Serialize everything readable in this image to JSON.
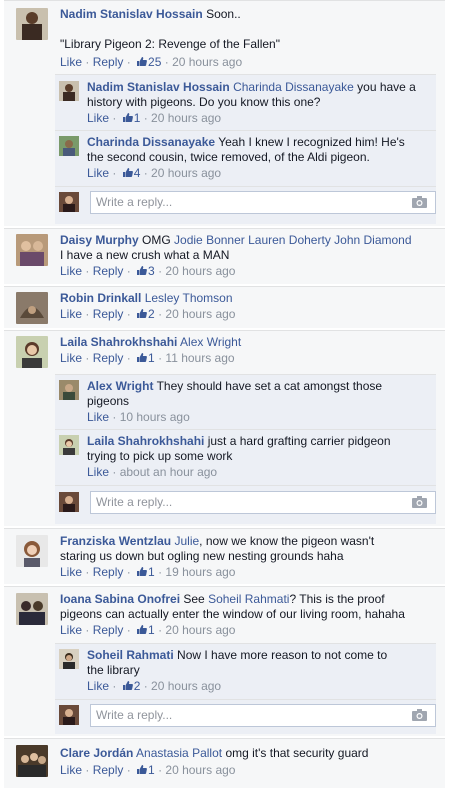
{
  "ui": {
    "like": "Like",
    "reply": "Reply",
    "reply_placeholder": "Write a reply..."
  },
  "comments": [
    {
      "name": "Nadim Stanislav Hossain",
      "text": "Soon..",
      "text2": "\"Library Pigeon 2: Revenge of the Fallen\"",
      "likes": "25",
      "time": "20 hours ago",
      "replies": [
        {
          "name": "Nadim Stanislav Hossain",
          "tag": "Charinda Dissanayake",
          "text": "you have a",
          "text2": "history with pigeons. Do you know this one?",
          "likes": "1",
          "time": "20 hours ago"
        },
        {
          "name": "Charinda Dissanayake",
          "text": "Yeah I knew I recognized him! He's",
          "text2": "the second cousin, twice removed, of the Aldi pigeon.",
          "likes": "4",
          "time": "20 hours ago"
        }
      ]
    },
    {
      "name": "Daisy Murphy",
      "text": "OMG",
      "tags": "Jodie Bonner Lauren Doherty John Diamond",
      "text2": "I have a new crush what a MAN",
      "likes": "3",
      "time": "20 hours ago"
    },
    {
      "name": "Robin Drinkall",
      "tag": "Lesley Thomson",
      "likes": "2",
      "time": "20 hours ago"
    },
    {
      "name": "Laila Shahrokhshahi",
      "tag": "Alex Wright",
      "likes": "1",
      "time": "11 hours ago",
      "replies": [
        {
          "name": "Alex Wright",
          "text": "They should have set a cat amongst those",
          "text2": "pigeons",
          "time": "10 hours ago"
        },
        {
          "name": "Laila Shahrokhshahi",
          "text": "just a hard grafting carrier pidgeon",
          "text2": "trying to pick up some work",
          "time": "about an hour ago"
        }
      ]
    },
    {
      "name": "Franziska Wentzlau",
      "tag": "Julie",
      "text": ", now we know the pigeon wasn't",
      "text2": "staring us down but ogling new nesting grounds haha",
      "likes": "1",
      "time": "19 hours ago"
    },
    {
      "name": "Ioana Sabina Onofrei",
      "text": "See",
      "tag": "Soheil Rahmati",
      "text_after": "? This is the proof",
      "text2": "pigeons can actually enter the window of our living room, hahaha",
      "likes": "1",
      "time": "20 hours ago",
      "replies": [
        {
          "name": "Soheil Rahmati",
          "text": "Now I have more reason to not come to",
          "text2": "the library",
          "likes": "2",
          "time": "20 hours ago"
        }
      ]
    },
    {
      "name": "Clare Jordán",
      "tag": "Anastasia Pallot",
      "text": "omg it's that security guard",
      "likes": "1",
      "time": "20 hours ago"
    }
  ],
  "colors": {
    "link": "#3b5998",
    "meta": "#89919c",
    "background": "#f6f7f8",
    "border": "#e1e2e3"
  },
  "icons": [
    "thumbs-up-icon",
    "camera-icon"
  ]
}
